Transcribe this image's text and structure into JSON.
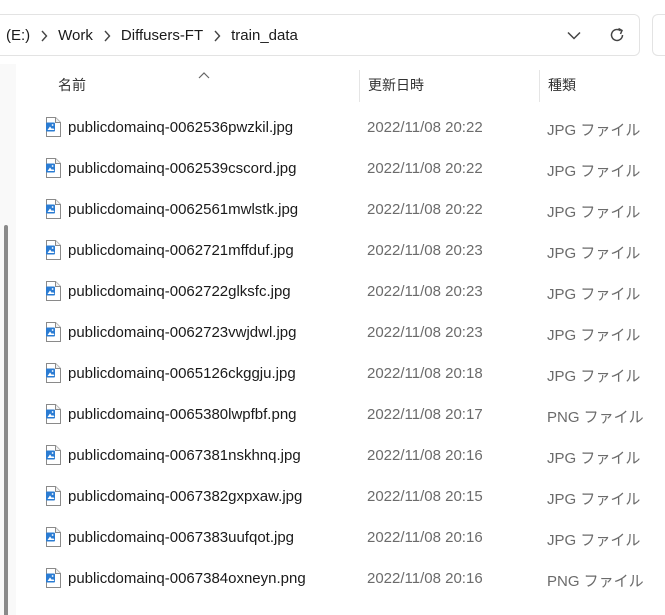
{
  "address_bar": {
    "crumbs": [
      "(E:)",
      "Work",
      "Diffusers-FT",
      "train_data"
    ],
    "history_icon": "chevron-down-icon",
    "refresh_icon": "refresh-icon"
  },
  "columns": {
    "name": "名前",
    "date": "更新日時",
    "type": "種類",
    "sorted_by": "name"
  },
  "files": [
    {
      "name": "publicdomainq-0062536pwzkil.jpg",
      "date": "2022/11/08 20:22",
      "type": "JPG ファイル"
    },
    {
      "name": "publicdomainq-0062539cscord.jpg",
      "date": "2022/11/08 20:22",
      "type": "JPG ファイル"
    },
    {
      "name": "publicdomainq-0062561mwlstk.jpg",
      "date": "2022/11/08 20:22",
      "type": "JPG ファイル"
    },
    {
      "name": "publicdomainq-0062721mffduf.jpg",
      "date": "2022/11/08 20:23",
      "type": "JPG ファイル"
    },
    {
      "name": "publicdomainq-0062722glksfc.jpg",
      "date": "2022/11/08 20:23",
      "type": "JPG ファイル"
    },
    {
      "name": "publicdomainq-0062723vwjdwl.jpg",
      "date": "2022/11/08 20:23",
      "type": "JPG ファイル"
    },
    {
      "name": "publicdomainq-0065126ckggju.jpg",
      "date": "2022/11/08 20:18",
      "type": "JPG ファイル"
    },
    {
      "name": "publicdomainq-0065380lwpfbf.png",
      "date": "2022/11/08 20:17",
      "type": "PNG ファイル"
    },
    {
      "name": "publicdomainq-0067381nskhnq.jpg",
      "date": "2022/11/08 20:16",
      "type": "JPG ファイル"
    },
    {
      "name": "publicdomainq-0067382gxpxaw.jpg",
      "date": "2022/11/08 20:15",
      "type": "JPG ファイル"
    },
    {
      "name": "publicdomainq-0067383uufqot.jpg",
      "date": "2022/11/08 20:16",
      "type": "JPG ファイル"
    },
    {
      "name": "publicdomainq-0067384oxneyn.png",
      "date": "2022/11/08 20:16",
      "type": "PNG ファイル"
    }
  ],
  "colors": {
    "icon_accent": "#2b7cd3",
    "muted_text": "#6b6b6b"
  }
}
